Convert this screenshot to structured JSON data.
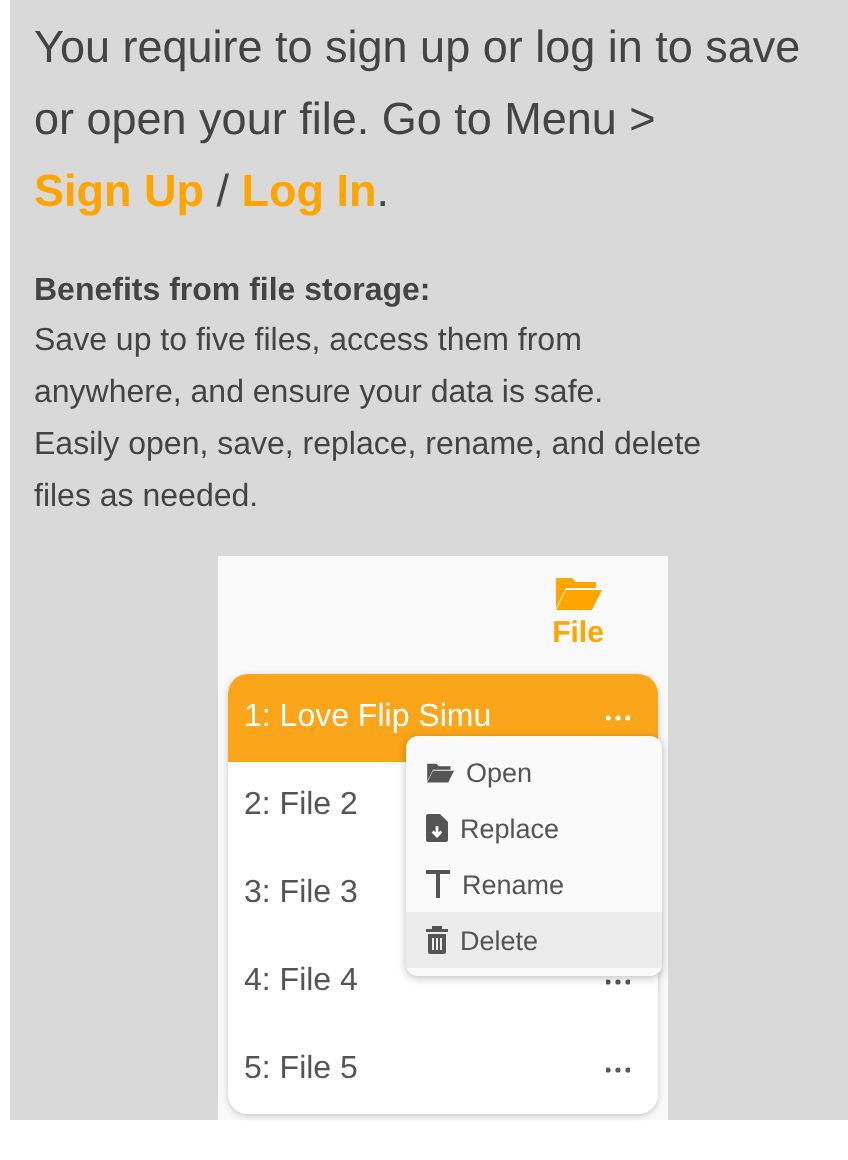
{
  "message": {
    "prefix": "You require to sign up or log in to save or open your file. Go to Menu >",
    "links": [
      {
        "label": "Sign Up"
      },
      {
        "label": "Log In"
      }
    ],
    "separator": "/",
    "suffix": "."
  },
  "benefits": {
    "title": "Benefits from file storage:",
    "paragraphs": [
      "Save up to five files, access them from anywhere, and ensure your data is safe.",
      "Easily open, save, replace, rename, and delete files as needed."
    ]
  },
  "preview": {
    "header": {
      "label": "File"
    },
    "files": [
      {
        "name": "1: Love Flip Simu",
        "selected": true
      },
      {
        "name": "2: File 2",
        "selected": false
      },
      {
        "name": "3: File 3",
        "selected": false
      },
      {
        "name": "4: File 4",
        "selected": false
      },
      {
        "name": "5: File 5",
        "selected": false
      }
    ],
    "menu": [
      {
        "kind": "open",
        "label": "Open",
        "hovered": false
      },
      {
        "kind": "replace",
        "label": "Replace",
        "hovered": false
      },
      {
        "kind": "rename",
        "label": "Rename",
        "hovered": false
      },
      {
        "kind": "delete",
        "label": "Delete",
        "hovered": true
      }
    ]
  }
}
